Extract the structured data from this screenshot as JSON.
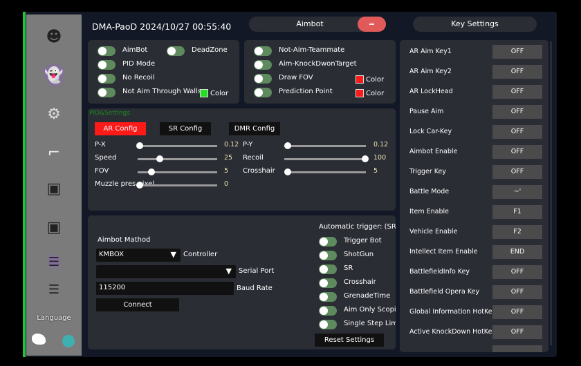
{
  "title": "DMA-PaoD 2024/10/27 00:55:40",
  "tabs": {
    "aimbot": "Aimbot",
    "menu_icon": "=",
    "key_settings": "Key Settings"
  },
  "colors": {
    "accent_green": "#22c33a",
    "red": "#ff1a1a",
    "toggle": "#5e8a5e",
    "menu_button": "#e05a5a"
  },
  "sidebar": {
    "icons": [
      "avatar-icon",
      "ghost-icon",
      "engine-icon",
      "pistol-icon",
      "box-1-icon",
      "box-2-icon",
      "layers-1-icon",
      "layers-2-icon"
    ],
    "language_label": "Language",
    "language_icons": [
      "china-map-icon",
      "globe-icon"
    ]
  },
  "panel1": {
    "aimbot": "AimBot",
    "deadzone": "DeadZone",
    "pid_mode": "PID Mode",
    "no_recoil": "No Recoil",
    "not_aim_walls": "Not Aim Through Walls",
    "color": "Color",
    "swatch": "#22dd22"
  },
  "panel2": {
    "not_aim_teammate": "Not-Aim-Teammate",
    "aim_knockdown": "Aim-KnockDwonTarget",
    "draw_fov": "Draw FOV",
    "prediction_point": "Prediction Point",
    "color": "Color",
    "swatch": "#ff1a1a"
  },
  "pid": {
    "title": "PID&Settings",
    "tabs": [
      "AR Config",
      "SR Config",
      "DMR Config"
    ],
    "active_tab": "AR Config",
    "sliders_left": [
      {
        "label": "P-X",
        "value": "0.12",
        "fraction": 0
      },
      {
        "label": "Speed",
        "value": "25",
        "fraction": 0.25
      },
      {
        "label": "FOV",
        "value": "5",
        "fraction": 0.15
      },
      {
        "label": "Muzzle pres.pixel",
        "value": "0",
        "fraction": 0
      }
    ],
    "sliders_right": [
      {
        "label": "P-Y",
        "value": "0.12",
        "fraction": 0
      },
      {
        "label": "Recoil",
        "value": "100",
        "fraction": 1
      },
      {
        "label": "Crosshair",
        "value": "5",
        "fraction": 0
      }
    ]
  },
  "method": {
    "title": "Aimbot Mathod",
    "controller_value": "KMBOX",
    "controller_label": "Controller",
    "serial_value": "",
    "serial_label": "Serial Port",
    "baud_value": "115200",
    "baud_label": "Baud Rate",
    "connect": "Connect"
  },
  "trigger": {
    "title": "Automatic trigger: (SR/S",
    "items": [
      "Trigger Bot",
      "ShotGun",
      "SR",
      "Crosshair",
      "GrenadeTime",
      "Aim Only Scopin",
      "Single Step Limi"
    ],
    "reset": "Reset Settings"
  },
  "keys": [
    {
      "label": "AR Aim Key1",
      "value": "OFF"
    },
    {
      "label": "AR Aim Key2",
      "value": "OFF"
    },
    {
      "label": "AR LockHead",
      "value": "OFF"
    },
    {
      "label": "Pause Aim",
      "value": "OFF"
    },
    {
      "label": "Lock Car-Key",
      "value": "OFF"
    },
    {
      "label": "Aimbot Enable",
      "value": "OFF"
    },
    {
      "label": "Trigger Key",
      "value": "OFF"
    },
    {
      "label": "Battle Mode",
      "value": "~'"
    },
    {
      "label": "Item Enable",
      "value": "F1"
    },
    {
      "label": "Vehicle Enable",
      "value": "F2"
    },
    {
      "label": "Intellect Item Enable",
      "value": "END"
    },
    {
      "label": "BattlefieldInfo Key",
      "value": "OFF"
    },
    {
      "label": "Battlefield Opera Key",
      "value": "OFF"
    },
    {
      "label": "Global Information HotKey",
      "value": "OFF"
    },
    {
      "label": "Active KnockDown HotKey",
      "value": "OFF"
    }
  ]
}
